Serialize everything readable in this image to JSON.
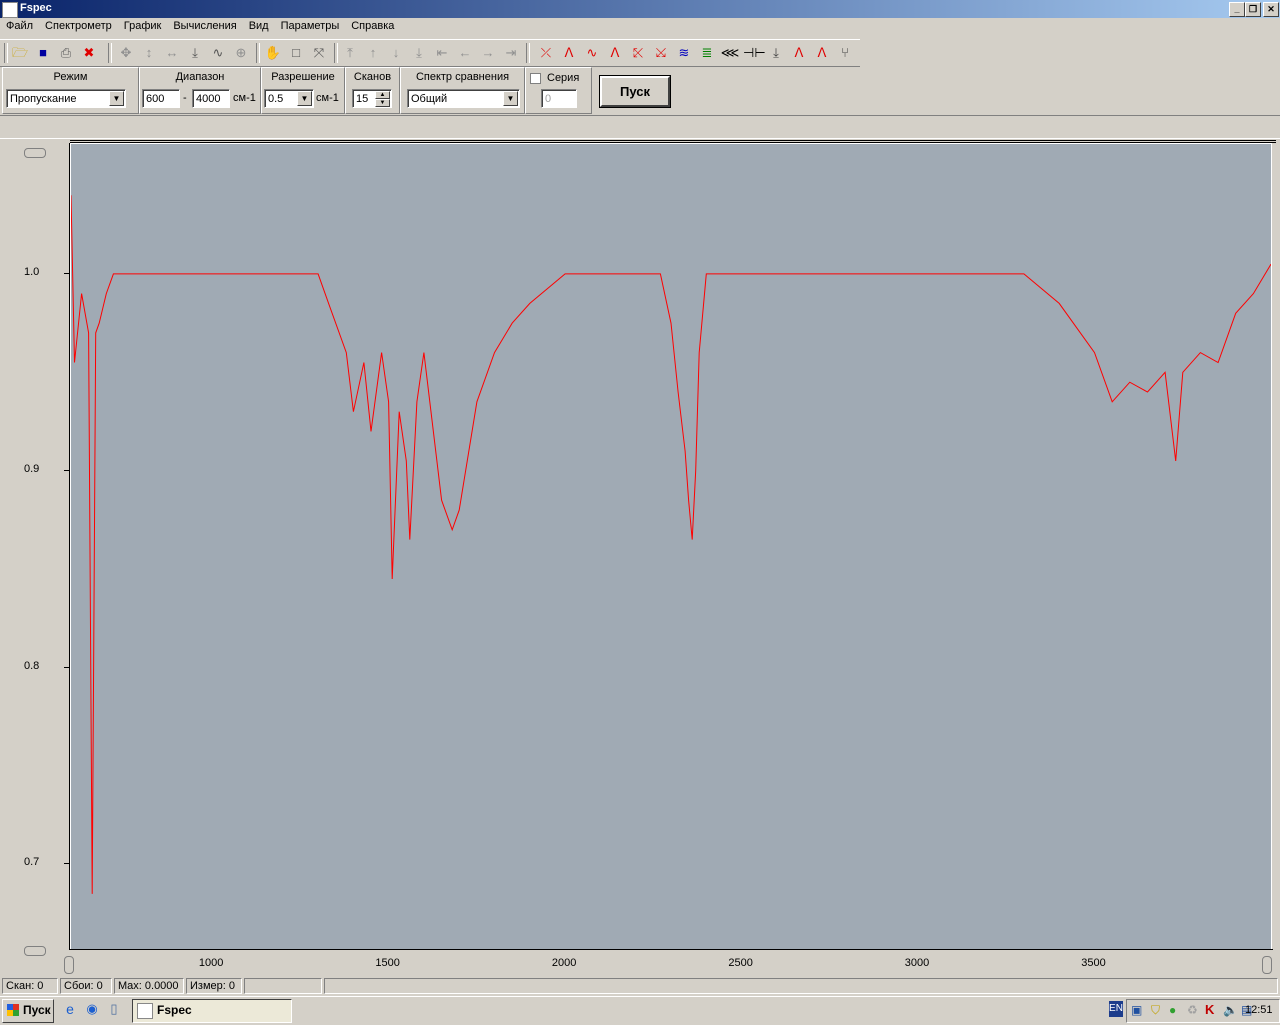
{
  "window": {
    "title": "Fspec"
  },
  "menu": [
    "Файл",
    "Спектрометр",
    "График",
    "Вычисления",
    "Вид",
    "Параметры",
    "Справка"
  ],
  "params": {
    "mode_label": "Режим",
    "mode_value": "Пропускание",
    "range_label": "Диапазон",
    "range_from": "600",
    "range_dash": "-",
    "range_to": "4000",
    "range_unit": "см-1",
    "resolution_label": "Разрешение",
    "resolution_value": "0.5",
    "resolution_unit": "см-1",
    "scans_label": "Сканов",
    "scans_value": "15",
    "compare_label": "Спектр сравнения",
    "compare_value": "Общий",
    "series_label": "Серия",
    "series_value": "0",
    "start_button": "Пуск"
  },
  "chart_data": {
    "type": "line",
    "color": "#ff0000",
    "background": "#a0aab4",
    "xlim": [
      600,
      4000
    ],
    "ylim": [
      0.657,
      1.066
    ],
    "xticks": [
      1000,
      1500,
      2000,
      2500,
      3000,
      3500
    ],
    "yticks": [
      0.7,
      0.8,
      0.9,
      1.0
    ],
    "ytick_labels": [
      "0.7",
      "0.8",
      "0.9",
      "1.0"
    ],
    "xtick_labels": [
      "1000",
      "1500",
      "2000",
      "2500",
      "3000",
      "3500"
    ],
    "series": [
      {
        "x": [
          600,
          610,
          630,
          650,
          660,
          670,
          680,
          700,
          720,
          800,
          900,
          1000,
          1100,
          1200,
          1300,
          1330,
          1380,
          1400,
          1430,
          1450,
          1480,
          1500,
          1510,
          1530,
          1550,
          1560,
          1580,
          1600,
          1650,
          1680,
          1700,
          1750,
          1800,
          1850,
          1900,
          2000,
          2100,
          2200,
          2270,
          2300,
          2320,
          2340,
          2350,
          2360,
          2370,
          2380,
          2400,
          2500,
          2600,
          2700,
          2800,
          2900,
          3000,
          3100,
          3200,
          3300,
          3400,
          3500,
          3550,
          3600,
          3650,
          3700,
          3730,
          3750,
          3800,
          3850,
          3900,
          3950,
          4000
        ],
        "y": [
          1.04,
          0.955,
          0.99,
          0.97,
          0.685,
          0.97,
          0.975,
          0.99,
          1.0,
          1.0,
          1.0,
          1.0,
          1.0,
          1.0,
          1.0,
          0.985,
          0.96,
          0.93,
          0.955,
          0.92,
          0.96,
          0.935,
          0.845,
          0.93,
          0.905,
          0.865,
          0.935,
          0.96,
          0.885,
          0.87,
          0.88,
          0.935,
          0.96,
          0.975,
          0.985,
          1.0,
          1.0,
          1.0,
          1.0,
          0.975,
          0.94,
          0.91,
          0.885,
          0.865,
          0.9,
          0.96,
          1.0,
          1.0,
          1.0,
          1.0,
          1.0,
          1.0,
          1.0,
          1.0,
          1.0,
          1.0,
          0.985,
          0.96,
          0.935,
          0.945,
          0.94,
          0.95,
          0.905,
          0.95,
          0.96,
          0.955,
          0.98,
          0.99,
          1.005
        ]
      }
    ]
  },
  "status": {
    "scan": "Скан: 0",
    "errors": "Сбои: 0",
    "max": "Max: 0.0000",
    "measure": "Измер: 0"
  },
  "taskbar": {
    "start": "Пуск",
    "app": "Fspec",
    "lang": "EN",
    "clock": "12:51"
  }
}
